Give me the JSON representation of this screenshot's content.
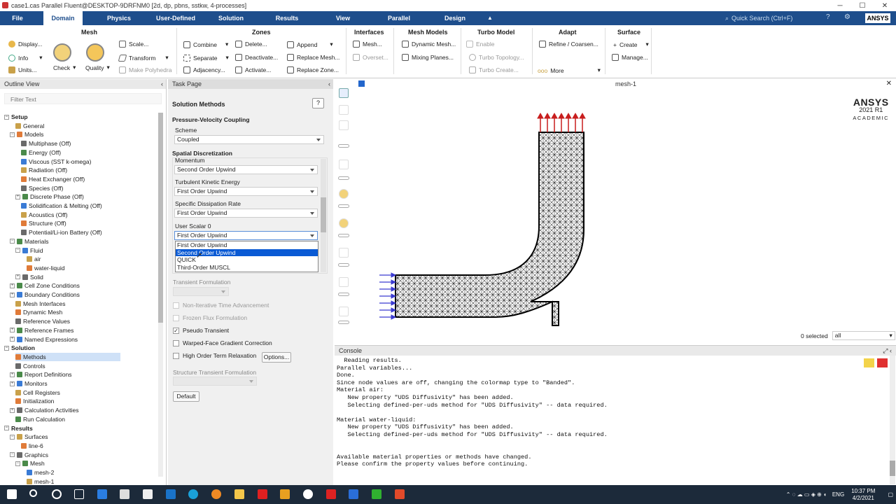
{
  "window": {
    "title": "case1.cas Parallel Fluent@DESKTOP-9DRFNM0  [2d, dp, pbns, sstkw, 4-processes]",
    "min": "─",
    "max": "☐",
    "close": "✕"
  },
  "menubar": {
    "items": [
      "File",
      "Domain",
      "Physics",
      "User-Defined",
      "Solution",
      "Results",
      "View",
      "Parallel",
      "Design"
    ],
    "active": "Domain",
    "quick_search": "Quick Search (Ctrl+F)",
    "logo": "ANSYS"
  },
  "ribbon": {
    "mesh": {
      "title": "Mesh",
      "display": "Display...",
      "info": "Info",
      "units": "Units...",
      "check": "Check",
      "quality": "Quality",
      "scale": "Scale...",
      "transform": "Transform",
      "make_polyhedra": "Make Polyhedra"
    },
    "zones": {
      "title": "Zones",
      "combine": "Combine",
      "separate": "Separate",
      "adjacency": "Adjacency...",
      "delete": "Delete...",
      "deactivate": "Deactivate...",
      "activate": "Activate...",
      "append": "Append",
      "replace_mesh": "Replace Mesh...",
      "replace_zone": "Replace Zone..."
    },
    "interfaces": {
      "title": "Interfaces",
      "mesh": "Mesh...",
      "overset": "Overset..."
    },
    "mesh_models": {
      "title": "Mesh Models",
      "dynamic_mesh": "Dynamic Mesh...",
      "mixing_planes": "Mixing Planes..."
    },
    "turbo_model": {
      "title": "Turbo Model",
      "enable": "Enable",
      "turbo_topology": "Turbo Topology...",
      "turbo_create": "Turbo Create..."
    },
    "adapt": {
      "title": "Adapt",
      "refine": "Refine / Coarsen...",
      "more": "More"
    },
    "surface": {
      "title": "Surface",
      "create": "Create",
      "manage": "Manage..."
    }
  },
  "outline": {
    "title": "Outline View",
    "filter_placeholder": "Filter Text",
    "items": [
      {
        "label": "Setup",
        "level": 0,
        "hdr": true,
        "exp": "−"
      },
      {
        "label": "General",
        "level": 2
      },
      {
        "label": "Models",
        "level": 1,
        "exp": "−"
      },
      {
        "label": "Multiphase (Off)",
        "level": 3
      },
      {
        "label": "Energy (Off)",
        "level": 3
      },
      {
        "label": "Viscous (SST k-omega)",
        "level": 3
      },
      {
        "label": "Radiation (Off)",
        "level": 3
      },
      {
        "label": "Heat Exchanger (Off)",
        "level": 3
      },
      {
        "label": "Species (Off)",
        "level": 3
      },
      {
        "label": "Discrete Phase (Off)",
        "level": 2,
        "exp": "+"
      },
      {
        "label": "Solidification & Melting (Off)",
        "level": 3
      },
      {
        "label": "Acoustics (Off)",
        "level": 3
      },
      {
        "label": "Structure (Off)",
        "level": 3
      },
      {
        "label": "Potential/Li-ion Battery (Off)",
        "level": 3
      },
      {
        "label": "Materials",
        "level": 1,
        "exp": "−"
      },
      {
        "label": "Fluid",
        "level": 2,
        "exp": "−"
      },
      {
        "label": "air",
        "level": 4
      },
      {
        "label": "water-liquid",
        "level": 4
      },
      {
        "label": "Solid",
        "level": 2,
        "exp": "+"
      },
      {
        "label": "Cell Zone Conditions",
        "level": 1,
        "exp": "+"
      },
      {
        "label": "Boundary Conditions",
        "level": 1,
        "exp": "+"
      },
      {
        "label": "Mesh Interfaces",
        "level": 2
      },
      {
        "label": "Dynamic Mesh",
        "level": 2
      },
      {
        "label": "Reference Values",
        "level": 2
      },
      {
        "label": "Reference Frames",
        "level": 1,
        "exp": "+"
      },
      {
        "label": "Named Expressions",
        "level": 1,
        "exp": "+"
      },
      {
        "label": "Solution",
        "level": 0,
        "hdr": true,
        "exp": "−"
      },
      {
        "label": "Methods",
        "level": 2,
        "sel": true
      },
      {
        "label": "Controls",
        "level": 2
      },
      {
        "label": "Report Definitions",
        "level": 1,
        "exp": "+"
      },
      {
        "label": "Monitors",
        "level": 1,
        "exp": "+"
      },
      {
        "label": "Cell Registers",
        "level": 2
      },
      {
        "label": "Initialization",
        "level": 2
      },
      {
        "label": "Calculation Activities",
        "level": 1,
        "exp": "+"
      },
      {
        "label": "Run Calculation",
        "level": 2
      },
      {
        "label": "Results",
        "level": 0,
        "hdr": true,
        "exp": "−"
      },
      {
        "label": "Surfaces",
        "level": 1,
        "exp": "−"
      },
      {
        "label": "line-6",
        "level": 3
      },
      {
        "label": "Graphics",
        "level": 1,
        "exp": "−"
      },
      {
        "label": "Mesh",
        "level": 2,
        "exp": "−"
      },
      {
        "label": "mesh-2",
        "level": 4
      },
      {
        "label": "mesh-1",
        "level": 4
      }
    ]
  },
  "task": {
    "title": "Task Page",
    "heading": "Solution Methods",
    "pv_coupling": "Pressure-Velocity Coupling",
    "scheme_label": "Scheme",
    "scheme_value": "Coupled",
    "spatial": "Spatial Discretization",
    "momentum_label": "Momentum",
    "momentum_value": "Second Order Upwind",
    "tke_label": "Turbulent Kinetic Energy",
    "tke_value": "First Order Upwind",
    "sdr_label": "Specific Dissipation Rate",
    "sdr_value": "First Order Upwind",
    "uds_label": "User Scalar 0",
    "uds_value": "First Order Upwind",
    "dropdown_options": [
      "First Order Upwind",
      "Second Order Upwind",
      "QUICK",
      "Third-Order MUSCL"
    ],
    "dropdown_highlight": "Second Order Upwind",
    "transient": "Transient Formulation",
    "non_iter": "Non-Iterative Time Advancement",
    "frozen_flux": "Frozen Flux Formulation",
    "pseudo": "Pseudo Transient",
    "warped": "Warped-Face Gradient Correction",
    "high_order": "High Order Term Relaxation",
    "options_btn": "Options...",
    "structure_transient": "Structure Transient Formulation",
    "default_btn": "Default"
  },
  "graphics": {
    "title": "mesh-1",
    "wm1": "ANSYS",
    "wm2": "2021 R1",
    "wm3": "ACADEMIC",
    "selected": "0 selected",
    "filter_value": "all"
  },
  "console": {
    "title": "Console",
    "text": "  Reading results.\nParallel variables...\nDone.\nSince node values are off, changing the colormap type to \"Banded\".\nMaterial air:\n   New property \"UDS Diffusivity\" has been added.\n   Selecting defined-per-uds method for \"UDS Diffusivity\" -- data required.\n\nMaterial water-liquid:\n   New property \"UDS Diffusivity\" has been added.\n   Selecting defined-per-uds method for \"UDS Diffusivity\" -- data required.\n\n\nAvailable material properties or methods have changed.\nPlease confirm the property values before continuing."
  },
  "taskbar": {
    "lang": "ENG",
    "time": "10:37 PM",
    "date": "4/2/2021"
  },
  "colors": {
    "menubar": "#1e4e8c",
    "selection": "#0a5ad4",
    "inlet_arrows": "#3a3ad0",
    "outlet_arrows": "#c81e1e"
  }
}
